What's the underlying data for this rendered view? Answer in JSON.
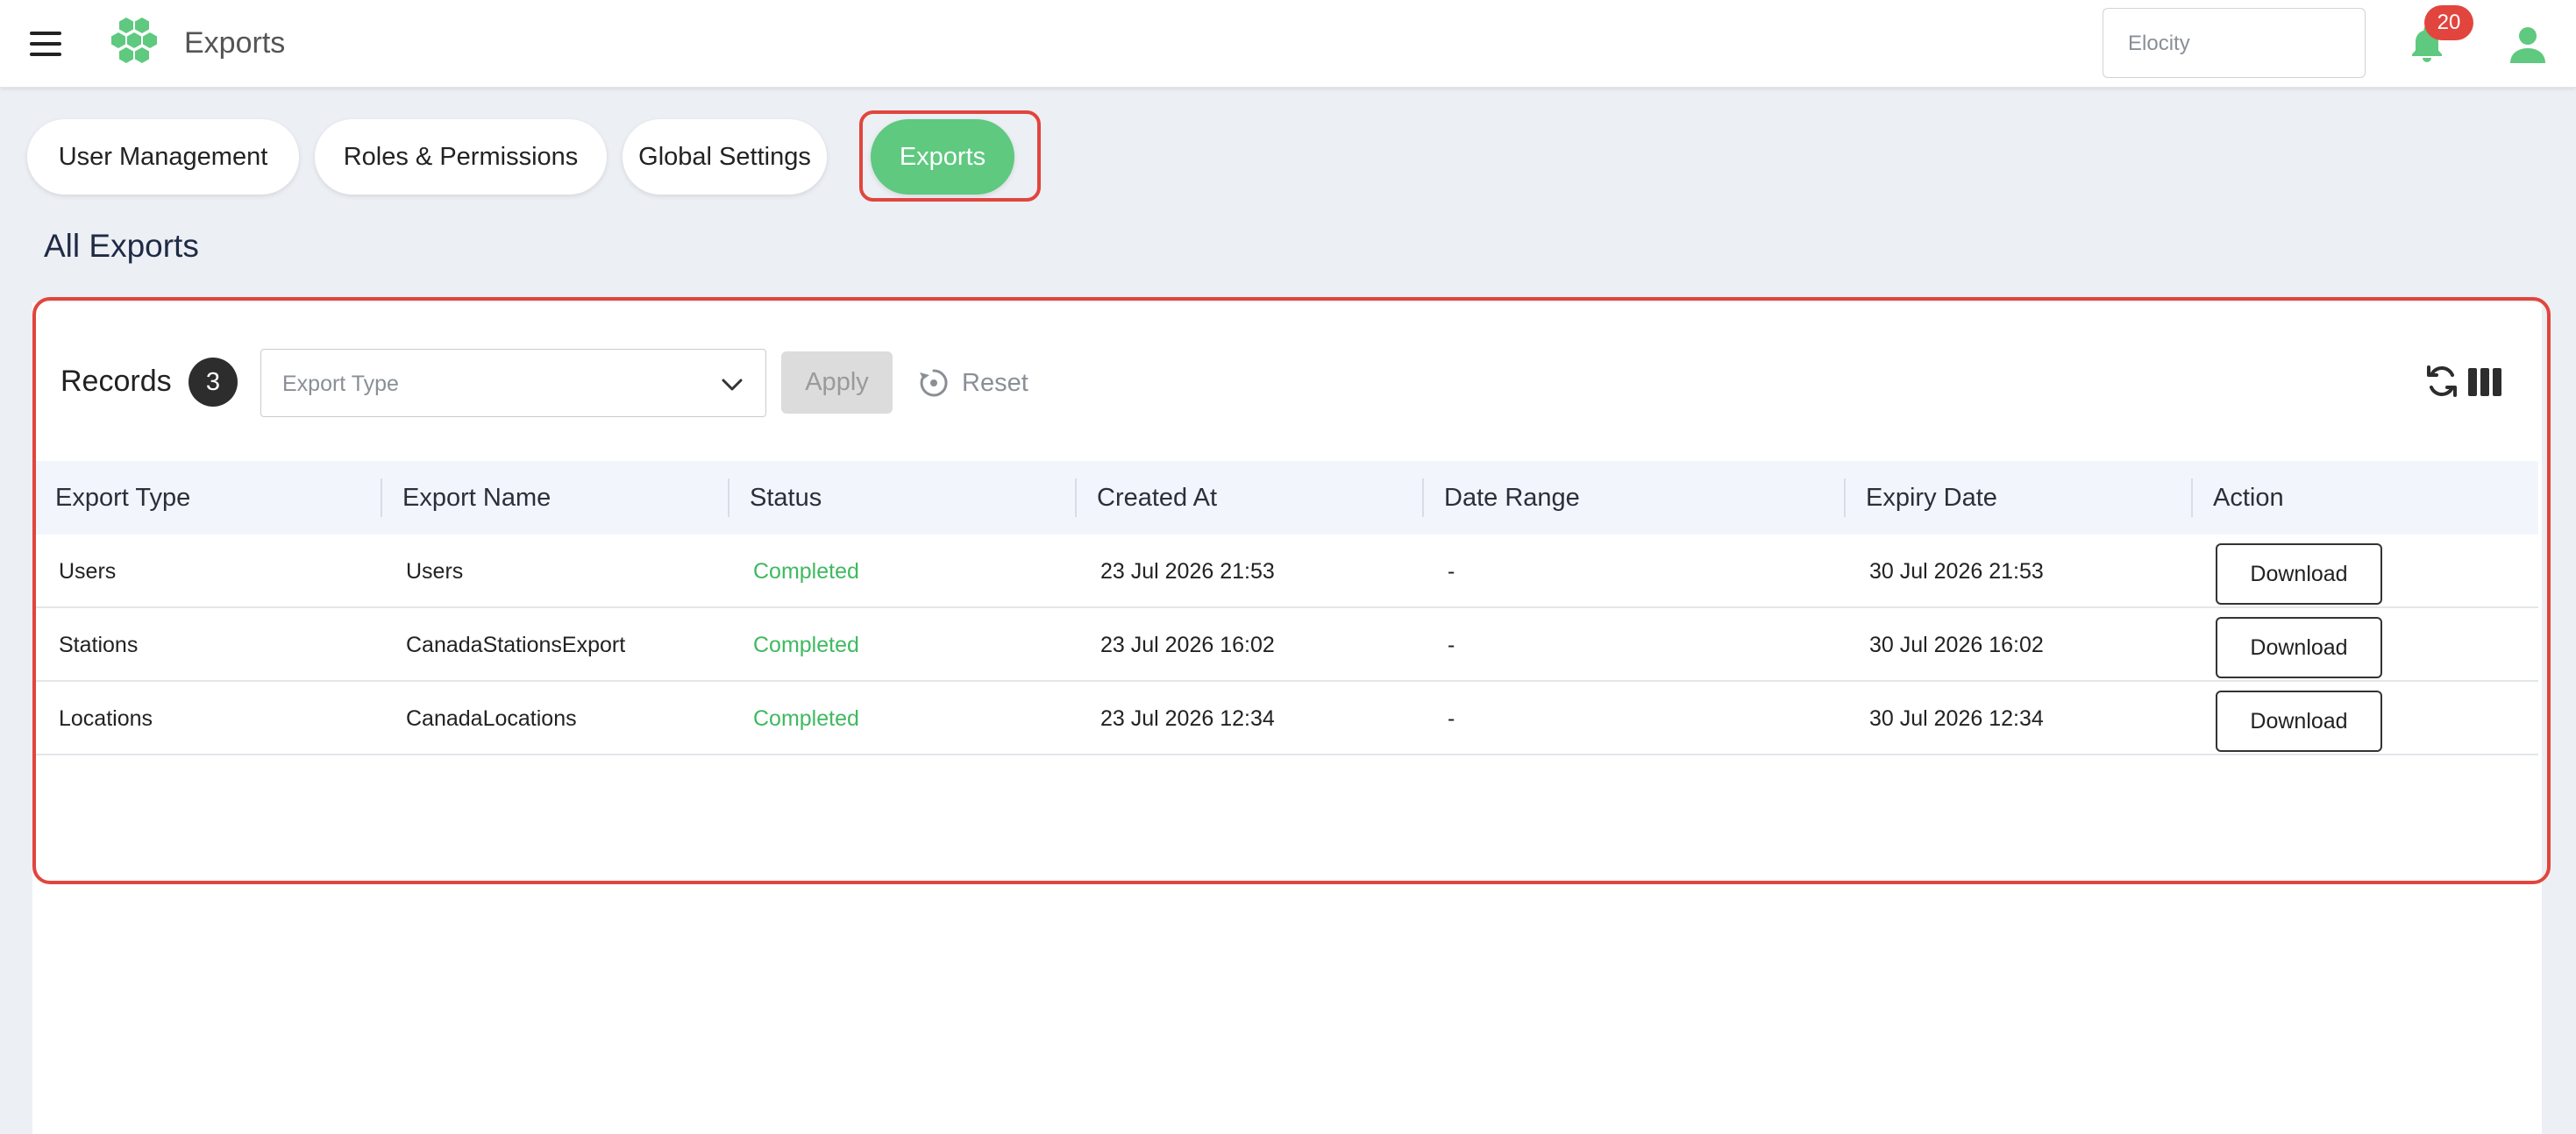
{
  "header": {
    "title": "Exports",
    "tenant_placeholder": "Elocity",
    "notification_count": "20",
    "icons": [
      "menu-icon",
      "hexagon-logo-icon",
      "bell-icon",
      "user-icon"
    ]
  },
  "tabs": [
    {
      "label": "User Management",
      "active": false
    },
    {
      "label": "Roles & Permissions",
      "active": false
    },
    {
      "label": "Global Settings",
      "active": false
    },
    {
      "label": "Exports",
      "active": true
    }
  ],
  "page": {
    "heading": "All Exports"
  },
  "toolbar": {
    "records_label": "Records",
    "records_count": "3",
    "export_type_placeholder": "Export Type",
    "apply_label": "Apply",
    "reset_label": "Reset"
  },
  "table": {
    "columns": [
      "Export Type",
      "Export Name",
      "Status",
      "Created At",
      "Date Range",
      "Expiry Date",
      "Action"
    ],
    "rows": [
      {
        "type": "Users",
        "name": "Users",
        "status": "Completed",
        "created": "23 Jul 2026 21:53",
        "range": "-",
        "expiry": "30 Jul 2026 21:53",
        "action": "Download"
      },
      {
        "type": "Stations",
        "name": "CanadaStationsExport",
        "status": "Completed",
        "created": "23 Jul 2026 16:02",
        "range": "-",
        "expiry": "30 Jul 2026 16:02",
        "action": "Download"
      },
      {
        "type": "Locations",
        "name": "CanadaLocations",
        "status": "Completed",
        "created": "23 Jul 2026 12:34",
        "range": "-",
        "expiry": "30 Jul 2026 12:34",
        "action": "Download"
      }
    ]
  },
  "colors": {
    "brand_green": "#5ec97f",
    "status_green": "#3fb960",
    "highlight_red": "#e1453d",
    "badge_red": "#e1453d"
  }
}
